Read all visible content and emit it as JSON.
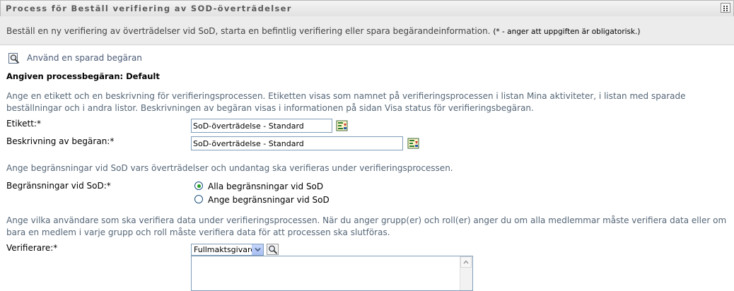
{
  "window": {
    "title": "Process för Beställ verifiering av SOD-överträdelser",
    "menu_icon": "menu-icon"
  },
  "intro": {
    "text": "Beställ en ny verifiering av överträdelser vid SoD, starta en befintlig verifiering eller spara begärandeinformation.",
    "required_note": "(* - anger att uppgiften är obligatorisk.)"
  },
  "saved_request": {
    "label": "Använd en sparad begäran",
    "icon": "search-document-icon"
  },
  "process_request": {
    "label": "Angiven processbegäran: Default"
  },
  "section_label": {
    "description": "Ange en etikett och en beskrivning för verifieringsprocessen. Etiketten visas som namnet på verifieringsprocessen i listan Mina aktiviteter, i listan med sparade beställningar och i andra listor. Beskrivningen av begäran visas i informationen på sidan Visa status för verifieringsbegäran.",
    "etikett_label": "Etikett:*",
    "etikett_value": "SoD-överträdelse - Standard",
    "beskrivning_label": "Beskrivning av begäran:*",
    "beskrivning_value": "SoD-överträdelse - Standard"
  },
  "section_constraints": {
    "description": "Ange begränsningar vid SoD vars överträdelser och undantag ska verifieras under verifieringsprocessen.",
    "label": "Begränsningar vid SoD:*",
    "options": [
      {
        "label": "Alla begränsningar vid SoD",
        "selected": true
      },
      {
        "label": "Ange begränsningar vid SoD",
        "selected": false
      }
    ]
  },
  "section_verifiers": {
    "description": "Ange vilka användare som ska verifiera data under verifieringsprocessen. När du anger grupp(er) och roll(er) anger du om alla medlemmar måste verifiera data eller om bara en medlem i varje grupp och roll måste verifiera data för att processen ska slutföras.",
    "label": "Verifierare:*",
    "select_value": "Fullmaktsgivare"
  }
}
